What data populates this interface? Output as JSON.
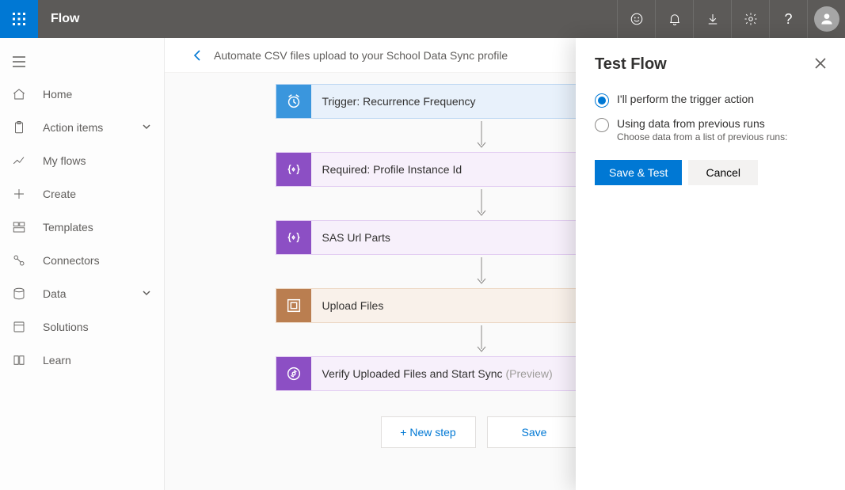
{
  "header": {
    "app_name": "Flow"
  },
  "leftnav": {
    "items": [
      {
        "label": "Home"
      },
      {
        "label": "Action items",
        "expandable": true
      },
      {
        "label": "My flows"
      },
      {
        "label": "Create"
      },
      {
        "label": "Templates"
      },
      {
        "label": "Connectors"
      },
      {
        "label": "Data",
        "expandable": true
      },
      {
        "label": "Solutions"
      },
      {
        "label": "Learn"
      }
    ]
  },
  "breadcrumb": {
    "title": "Automate CSV files upload to your School Data Sync profile"
  },
  "flow_steps": [
    {
      "label": "Trigger: Recurrence Frequency",
      "kind": "blue",
      "icon": "clock"
    },
    {
      "label": "Required: Profile Instance Id",
      "kind": "purple",
      "icon": "code"
    },
    {
      "label": "SAS Url Parts",
      "kind": "purple",
      "icon": "code"
    },
    {
      "label": "Upload Files",
      "kind": "brown",
      "icon": "frame"
    },
    {
      "label": "Verify Uploaded Files and Start Sync",
      "preview": "(Preview)",
      "kind": "purple",
      "icon": "sync"
    }
  ],
  "bottom_actions": {
    "new_step": "+ New step",
    "save": "Save"
  },
  "panel": {
    "title": "Test Flow",
    "opt1_label": "I'll perform the trigger action",
    "opt2_label": "Using data from previous runs",
    "opt2_sub": "Choose data from a list of previous runs:",
    "save_test": "Save & Test",
    "cancel": "Cancel"
  }
}
